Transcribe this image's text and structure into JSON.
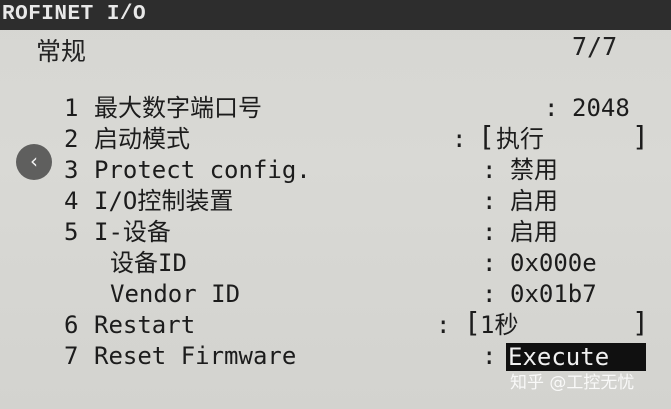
{
  "window": {
    "title": "ROFINET I/O"
  },
  "header": {
    "title": "常规",
    "page": "7/7"
  },
  "rows": [
    {
      "num": "1",
      "label": "最大数字端口号",
      "value": "2048"
    },
    {
      "num": "2",
      "label": "启动模式",
      "value": "执行"
    },
    {
      "num": "3",
      "label": "Protect config.",
      "value": "禁用"
    },
    {
      "num": "4",
      "label": "I/O控制装置",
      "value": "启用"
    },
    {
      "num": "5",
      "label": "I-设备",
      "value": "启用"
    },
    {
      "num": "",
      "label": "设备ID",
      "value": "0x000e"
    },
    {
      "num": "",
      "label": "Vendor ID",
      "value": "0x01b7"
    },
    {
      "num": "6",
      "label": "Restart",
      "value": "1秒"
    },
    {
      "num": "7",
      "label": "Reset Firmware",
      "value": "Execute"
    }
  ],
  "symbols": {
    "colon": ":",
    "left_bracket": "[",
    "right_bracket": "]"
  },
  "overlay": {
    "back_glyph": "‹",
    "watermark": "知乎 @工控无忧"
  },
  "colors": {
    "title_bar": "#2d2d2d",
    "screen": "#d6d6d2",
    "highlight": "#101010"
  }
}
